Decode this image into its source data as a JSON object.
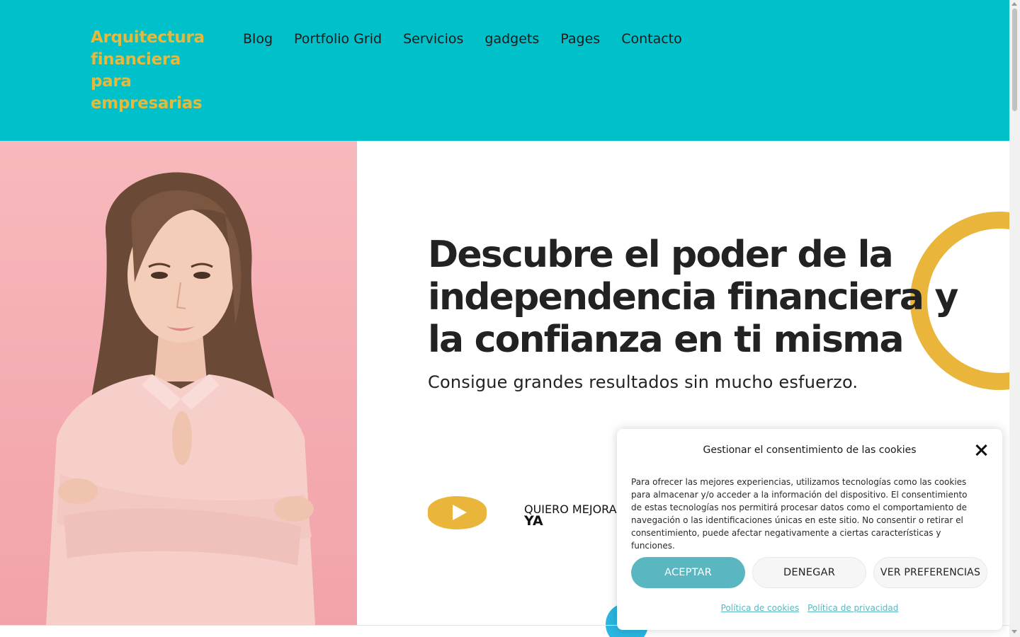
{
  "header": {
    "logo_text": "Arquitectura financiera para empresarias",
    "nav": [
      {
        "label": "Blog"
      },
      {
        "label": "Portfolio Grid"
      },
      {
        "label": "Servicios"
      },
      {
        "label": "gadgets"
      },
      {
        "label": "Pages"
      },
      {
        "label": "Contacto"
      }
    ]
  },
  "hero": {
    "image": "woman-portrait-pink-background",
    "headline": "Descubre el poder de la independencia financiera y la confianza en ti misma",
    "subheadline": "Consigue grandes resultados sin mucho esfuerzo.",
    "play_icon": "play-icon",
    "cta_line1": "QUIERO MEJORAR",
    "cta_line2": "YA"
  },
  "cookie_dialog": {
    "title": "Gestionar el consentimiento de las cookies",
    "close_icon": "close-icon",
    "body": "Para ofrecer las mejores experiencias, utilizamos tecnologías como las cookies para almacenar y/o acceder a la información del dispositivo. El consentimiento de estas tecnologías nos permitirá procesar datos como el comportamiento de navegación o las identificaciones únicas en este sitio. No consentir o retirar el consentimiento, puede afectar negativamente a ciertas características y funciones.",
    "accept_label": "ACEPTAR",
    "deny_label": "DENEGAR",
    "prefs_label": "VER PREFERENCIAS",
    "cookie_policy_link": "Política de cookies",
    "privacy_policy_link": "Política de privacidad"
  },
  "colors": {
    "header_bg": "#00c0c9",
    "logo": "#e6b83c",
    "accent_yellow": "#e9b53a",
    "accept_button": "#5ab7c2",
    "hero_image_bg": "#f4aab1"
  }
}
